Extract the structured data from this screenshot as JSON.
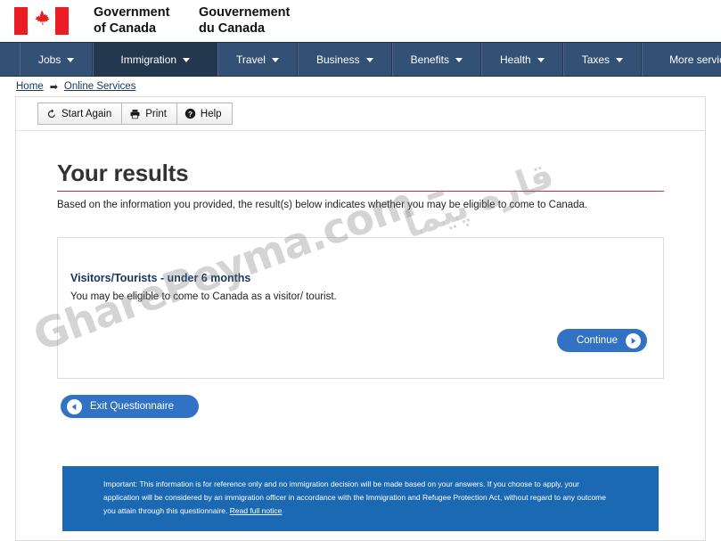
{
  "brand": {
    "flag_icon": "canada-flag-icon",
    "maple_leaf": "☘",
    "name_en_line1": "Government",
    "name_en_line2": "of Canada",
    "name_fr_line1": "Gouvernement",
    "name_fr_line2": "du Canada"
  },
  "nav": {
    "items": [
      {
        "label": "Jobs",
        "active": false
      },
      {
        "label": "Immigration",
        "active": true
      },
      {
        "label": "Travel",
        "active": false
      },
      {
        "label": "Business",
        "active": false
      },
      {
        "label": "Benefits",
        "active": false
      },
      {
        "label": "Health",
        "active": false
      },
      {
        "label": "Taxes",
        "active": false
      },
      {
        "label": "More services",
        "active": false
      }
    ]
  },
  "breadcrumb": {
    "home": "Home",
    "separator": "➡",
    "current": "Online Services"
  },
  "toolbar": {
    "start_again_label": "Start Again",
    "print_label": "Print",
    "help_label": "Help"
  },
  "main": {
    "title": "Your results",
    "lede": "Based on the information you provided, the result(s) below indicates whether you may be eligible to come to Canada.",
    "result": {
      "heading": "Visitors/Tourists - under 6 months",
      "text": "You may be eligible to come to Canada as a visitor/ tourist."
    },
    "continue_label": "Continue",
    "exit_label": "Exit Questionnaire"
  },
  "notice": {
    "text": "Important: This information is for reference only and no immigration decision will be made based on your answers. If you choose to apply, your application will be considered by an immigration officer in accordance with the Immigration and Refugee Protection Act, without regard to any outcome you attain through this questionnaire. ",
    "link_label": "Read full notice"
  },
  "watermark": {
    "latin": "GharePeyma.com –",
    "persian": "قاره پیما"
  },
  "colors": {
    "nav_bg": "#335075",
    "nav_active": "#23384f",
    "flag_red": "#ec1c24",
    "title_rule": "#9e3b4c",
    "button_blue": "#3172c4",
    "notice_blue": "#1c69b3",
    "heading_navy": "#15355e"
  }
}
